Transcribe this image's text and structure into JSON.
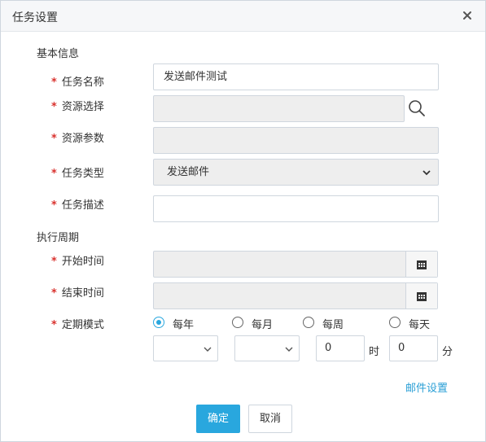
{
  "dialog": {
    "title": "任务设置",
    "close_icon": "close-icon"
  },
  "sections": {
    "basic": "基本信息",
    "schedule": "执行周期"
  },
  "required_mark": "*",
  "fields": {
    "task_name": {
      "label": "任务名称",
      "value": "发送邮件测试"
    },
    "resource_select": {
      "label": "资源选择",
      "value": ""
    },
    "resource_params": {
      "label": "资源参数",
      "value": ""
    },
    "task_type": {
      "label": "任务类型",
      "value": "发送邮件"
    },
    "task_desc": {
      "label": "任务描述",
      "value": ""
    },
    "start_time": {
      "label": "开始时间",
      "value": ""
    },
    "end_time": {
      "label": "结束时间",
      "value": ""
    },
    "schedule_mode": {
      "label": "定期模式",
      "options": [
        "每年",
        "每月",
        "每周",
        "每天"
      ],
      "selected": "每年"
    }
  },
  "time": {
    "hour_value": "0",
    "hour_unit": "时",
    "minute_value": "0",
    "minute_unit": "分"
  },
  "links": {
    "mail_settings": "邮件设置"
  },
  "buttons": {
    "ok": "确定",
    "cancel": "取消"
  },
  "colors": {
    "accent": "#29a7de",
    "required": "#d9322e",
    "link": "#2a9fd6"
  }
}
